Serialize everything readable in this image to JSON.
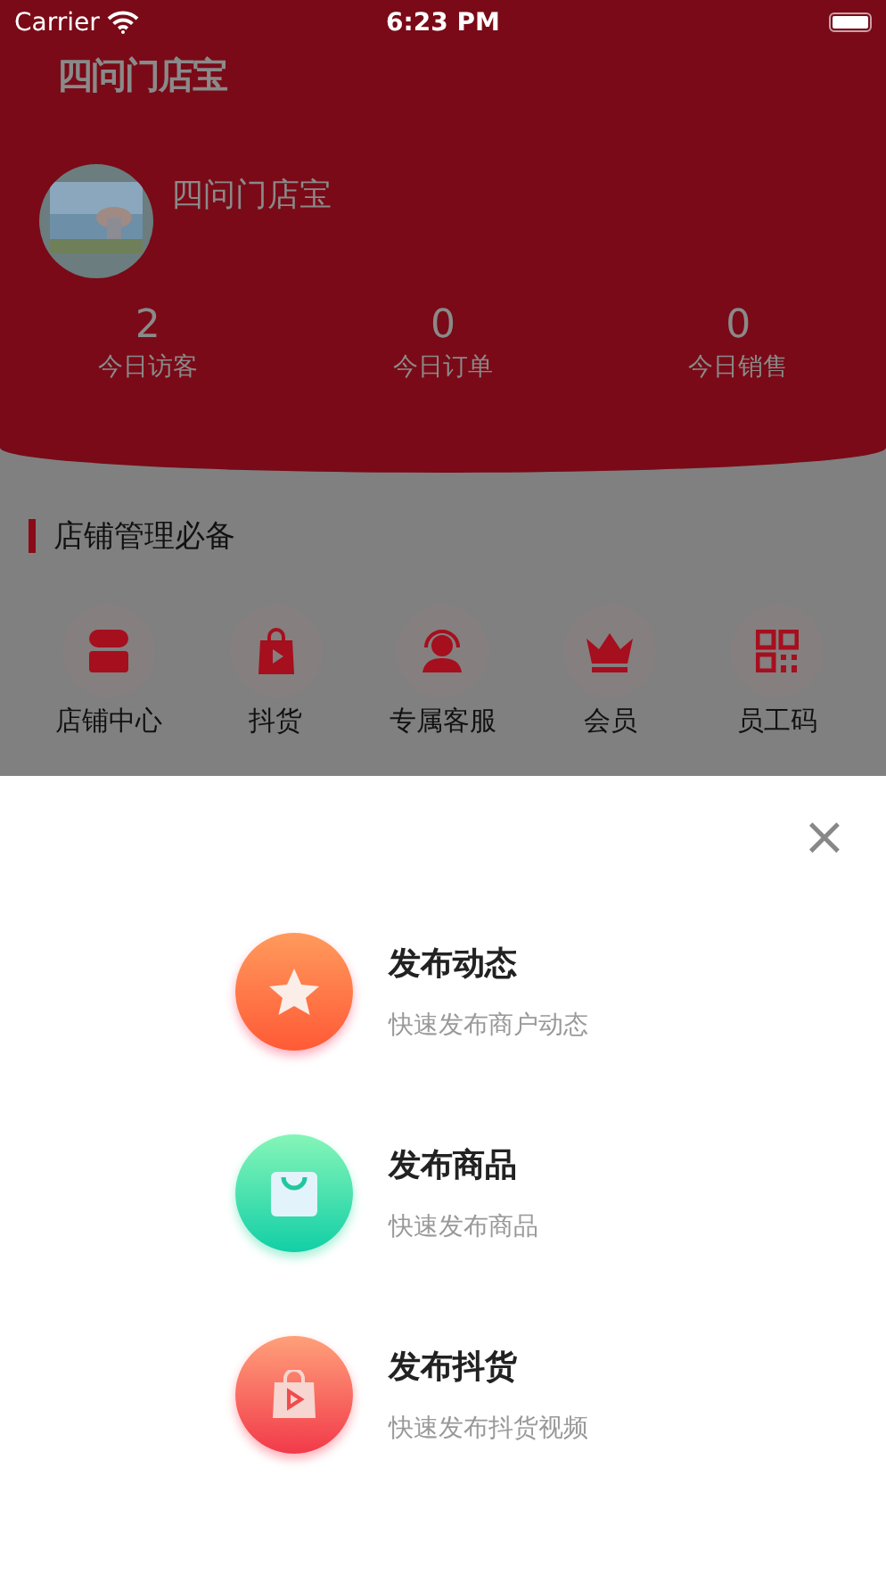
{
  "status_bar": {
    "carrier": "Carrier",
    "time": "6:23 PM"
  },
  "header": {
    "logo": "四问门店宝",
    "store_name": "四问门店宝",
    "stats": [
      {
        "value": "2",
        "label": "今日访客"
      },
      {
        "value": "0",
        "label": "今日订单"
      },
      {
        "value": "0",
        "label": "今日销售"
      }
    ]
  },
  "section": {
    "title": "店铺管理必备",
    "tools": [
      {
        "kind": "store",
        "label": "店铺中心"
      },
      {
        "kind": "bag",
        "label": "抖货"
      },
      {
        "kind": "headset",
        "label": "专属客服"
      },
      {
        "kind": "crown",
        "label": "会员"
      },
      {
        "kind": "qr",
        "label": "员工码"
      }
    ]
  },
  "publish_sheet": {
    "close": "×",
    "items": [
      {
        "kind": "star",
        "title": "发布动态",
        "subtitle": "快速发布商户动态"
      },
      {
        "kind": "bag",
        "title": "发布商品",
        "subtitle": "快速发布商品"
      },
      {
        "kind": "video",
        "title": "发布抖货",
        "subtitle": "快速发布抖货视频"
      }
    ]
  }
}
